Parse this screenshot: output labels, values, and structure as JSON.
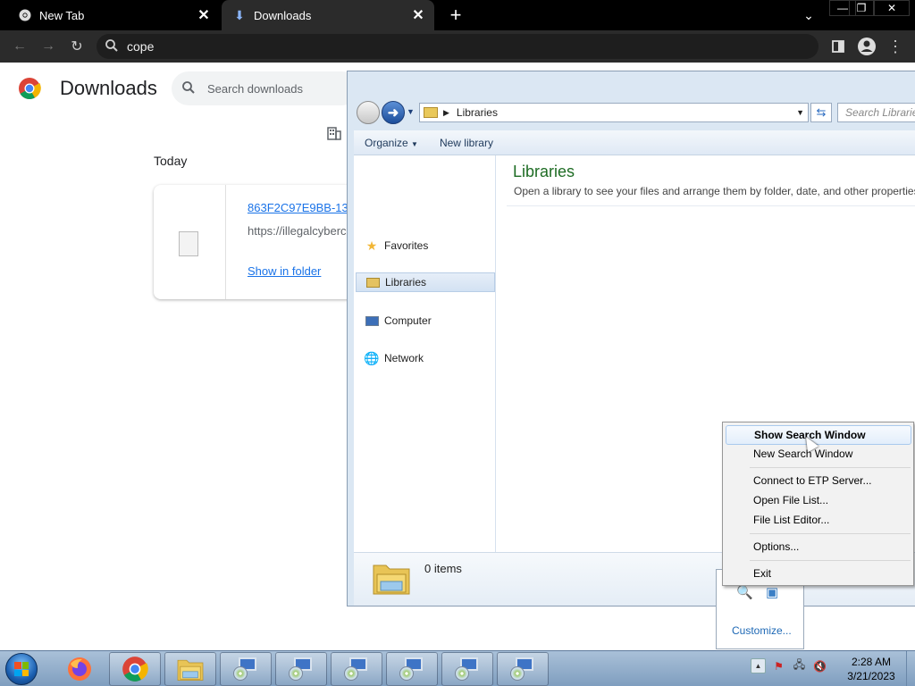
{
  "browser": {
    "tabs": [
      {
        "title": "New Tab"
      },
      {
        "title": "Downloads"
      }
    ],
    "omnibox": {
      "value": "cope"
    }
  },
  "downloads_page": {
    "title": "Downloads",
    "search_placeholder": "Search downloads",
    "section_label": "Today",
    "item": {
      "filename": "863F2C97E9BB-13",
      "url": "https://illegalcyberc",
      "action": "Show in folder"
    }
  },
  "explorer": {
    "address": "Libraries",
    "search_placeholder": "Search Librarie",
    "commands": [
      "Organize",
      "New library"
    ],
    "nav": [
      {
        "label": "Favorites",
        "icon": "star-icon"
      },
      {
        "label": "Libraries",
        "icon": "library-icon",
        "selected": true
      },
      {
        "label": "Computer",
        "icon": "computer-icon"
      },
      {
        "label": "Network",
        "icon": "network-icon"
      }
    ],
    "heading": "Libraries",
    "subheading": "Open a library to see your files and arrange them by folder, date, and other properties.",
    "status": "0 items"
  },
  "context_menu": {
    "items": [
      "Show Search Window",
      "New Search Window",
      "Connect to ETP Server...",
      "Open File List...",
      "File List Editor...",
      "Options...",
      "Exit"
    ]
  },
  "tray_flyout": {
    "customize": "Customize..."
  },
  "taskbar": {
    "time": "2:28 AM",
    "date": "3/21/2023"
  },
  "colors": {
    "accent_link": "#1a73e8",
    "libraries_heading": "#1e6c24"
  }
}
